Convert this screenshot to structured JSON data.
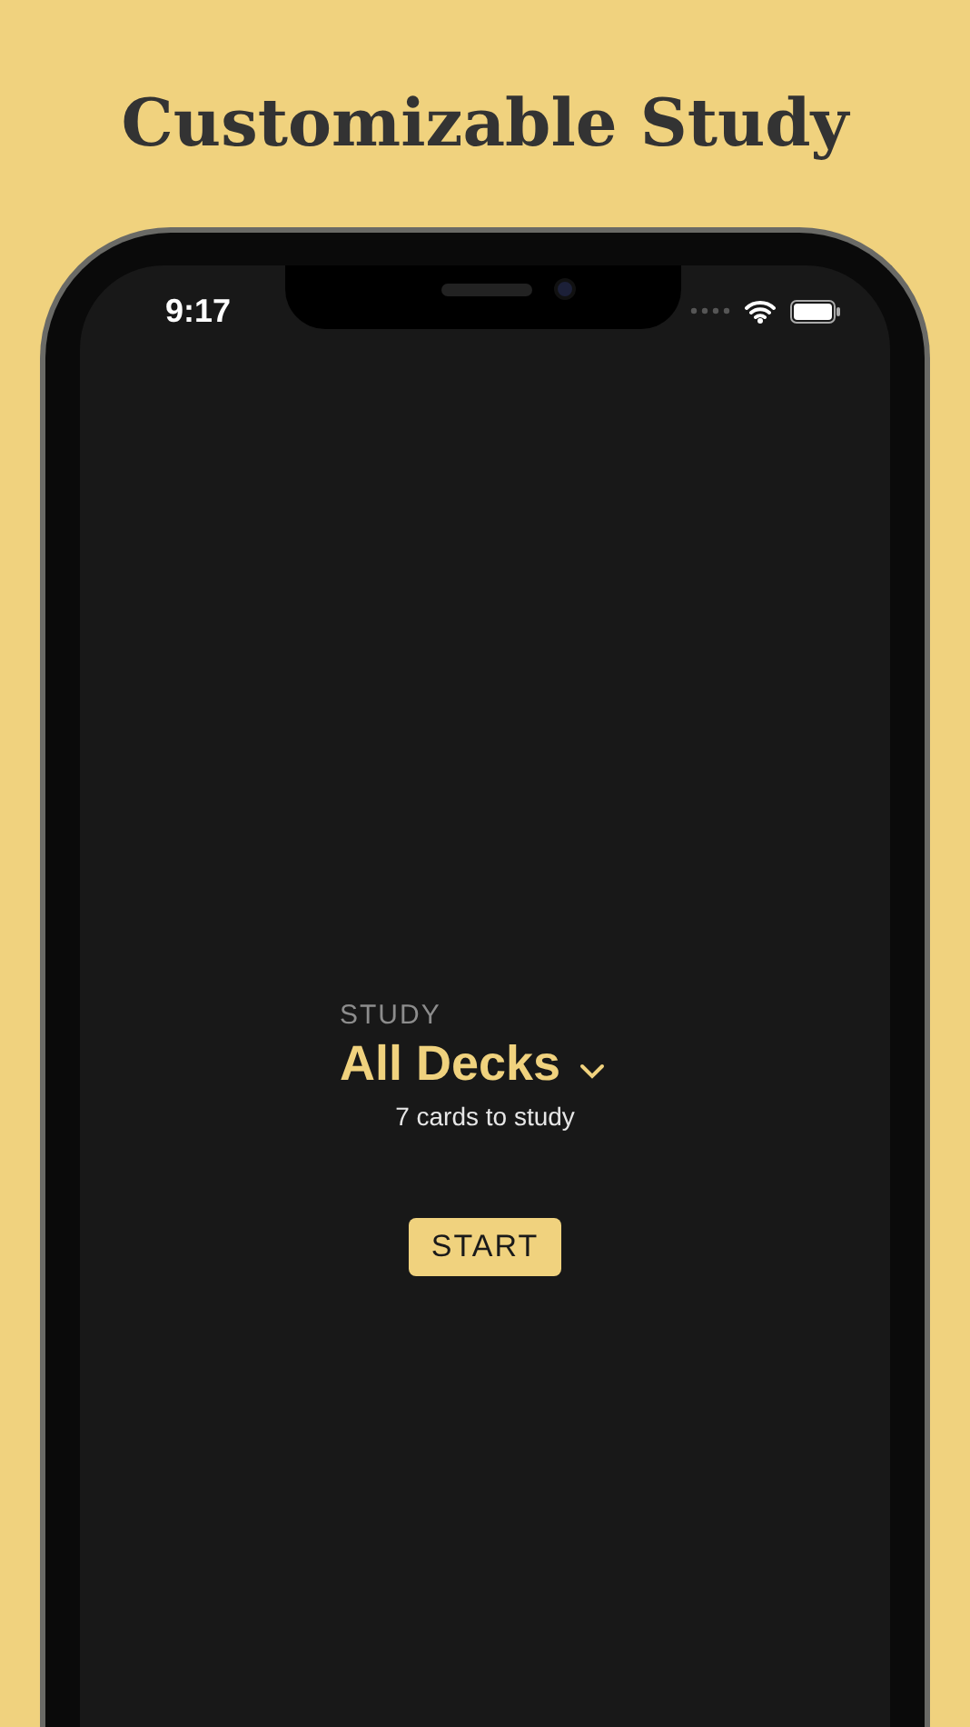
{
  "headline": "Customizable Study",
  "status_bar": {
    "time": "9:17"
  },
  "study": {
    "label": "STUDY",
    "deck": "All Decks",
    "count": "7 cards to study"
  },
  "start_button": {
    "label": "START"
  }
}
